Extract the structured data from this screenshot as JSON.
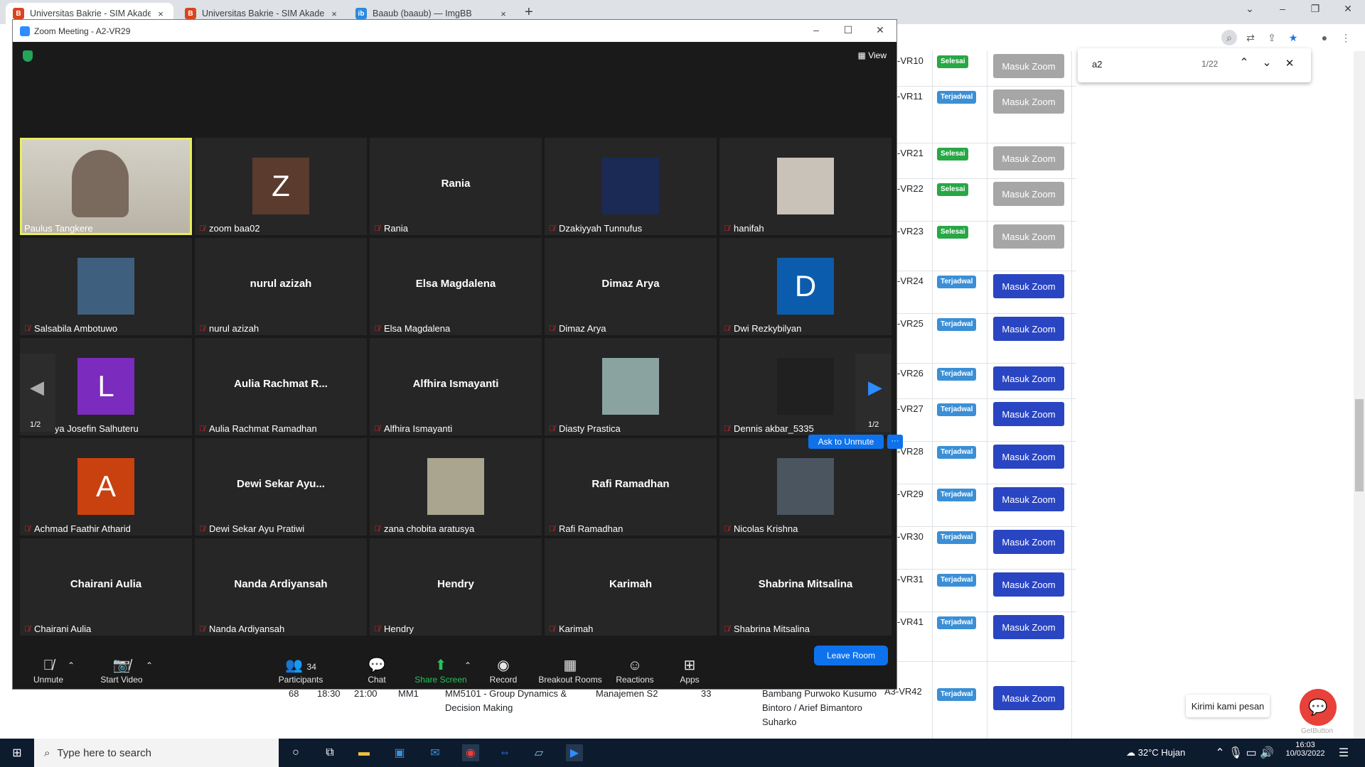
{
  "browser": {
    "tabs": [
      {
        "title": "Universitas Bakrie - SIM Akadem",
        "fav": "B",
        "favColor": "#d9451f"
      },
      {
        "title": "Universitas Bakrie - SIM Akadem",
        "fav": "B",
        "favColor": "#d9451f"
      },
      {
        "title": "Baaub (baaub) — ImgBB",
        "fav": "ib",
        "favColor": "#2b8ae0"
      }
    ],
    "new_tab": "+",
    "close": "×"
  },
  "find": {
    "query": "a2",
    "count": "1/22"
  },
  "schedule": {
    "rows": [
      {
        "room": "-VR10",
        "status": "Selesai",
        "button": "Masuk Zoom",
        "enabled": false
      },
      {
        "room": "-VR11",
        "status": "Terjadwal",
        "button": "Masuk Zoom",
        "enabled": false
      },
      {
        "room": "-VR21",
        "status": "Selesai",
        "button": "Masuk Zoom",
        "enabled": false
      },
      {
        "room": "-VR22",
        "status": "Selesai",
        "button": "Masuk Zoom",
        "enabled": false
      },
      {
        "room": "-VR23",
        "status": "Selesai",
        "button": "Masuk Zoom",
        "enabled": false
      },
      {
        "room": "-VR24",
        "status": "Terjadwal",
        "button": "Masuk Zoom",
        "enabled": true
      },
      {
        "room": "-VR25",
        "status": "Terjadwal",
        "button": "Masuk Zoom",
        "enabled": true
      },
      {
        "room": "-VR26",
        "status": "Terjadwal",
        "button": "Masuk Zoom",
        "enabled": true
      },
      {
        "room": "-VR27",
        "status": "Terjadwal",
        "button": "Masuk Zoom",
        "enabled": true
      },
      {
        "room": "-VR28",
        "status": "Terjadwal",
        "button": "Masuk Zoom",
        "enabled": true
      },
      {
        "room": "-VR29",
        "status": "Terjadwal",
        "button": "Masuk Zoom",
        "enabled": true
      },
      {
        "room": "-VR30",
        "status": "Terjadwal",
        "button": "Masuk Zoom",
        "enabled": true
      },
      {
        "room": "-VR31",
        "status": "Terjadwal",
        "button": "Masuk Zoom",
        "enabled": true
      },
      {
        "room": "-VR41",
        "status": "Terjadwal",
        "button": "Masuk Zoom",
        "enabled": true
      }
    ],
    "last_row": {
      "no": "68",
      "start": "18:30",
      "end": "21:00",
      "class": "MM1",
      "course": "MM5101 - Group Dynamics & Decision Making",
      "program": "Manajemen S2",
      "count": "33",
      "lecturer": "Bambang Purwoko Kusumo Bintoro / Arief Bimantoro Suharko",
      "room": "A3-VR42",
      "status": "Terjadwal",
      "button": "Masuk Zoom"
    }
  },
  "chat_widget": {
    "label": "Kirimi kami pesan",
    "brand": "GetButton"
  },
  "zoom": {
    "title": "Zoom Meeting - A2-VR29",
    "view": "View",
    "page_indicator": "1/2",
    "ask_to_unmute": "Ask to Unmute",
    "more": "···",
    "participants": [
      {
        "name": "Paulus Tangkere",
        "big": "",
        "avatar": "video",
        "color": ""
      },
      {
        "name": "zoom baa02",
        "big": "",
        "avatar": "Z",
        "color": "#5a3b2e"
      },
      {
        "name": "Rania",
        "big": "Rania",
        "avatar": "",
        "color": ""
      },
      {
        "name": "Dzakiyyah Tunnufus",
        "big": "",
        "avatar": "photo",
        "color": "#1b2a55"
      },
      {
        "name": "hanifah",
        "big": "",
        "avatar": "photo",
        "color": "#c8c2b8"
      },
      {
        "name": "Salsabila Ambotuwo",
        "big": "",
        "avatar": "photo",
        "color": "#3f5f7f"
      },
      {
        "name": "nurul azizah",
        "big": "nurul azizah",
        "avatar": "",
        "color": ""
      },
      {
        "name": "Elsa Magdalena",
        "big": "Elsa Magdalena",
        "avatar": "",
        "color": ""
      },
      {
        "name": "Dimaz Arya",
        "big": "Dimaz Arya",
        "avatar": "",
        "color": ""
      },
      {
        "name": "Dwi Rezkybilyan",
        "big": "",
        "avatar": "D",
        "color": "#0b5cad"
      },
      {
        "name": "Loudya Josefin Salhuteru",
        "big": "",
        "avatar": "L",
        "color": "#7b2bbd"
      },
      {
        "name": "Aulia Rachmat Ramadhan",
        "big": "Aulia Rachmat R...",
        "avatar": "",
        "color": ""
      },
      {
        "name": "Alfhira Ismayanti",
        "big": "Alfhira Ismayanti",
        "avatar": "",
        "color": ""
      },
      {
        "name": "Diasty Prastica",
        "big": "",
        "avatar": "photo",
        "color": "#8aa3a0"
      },
      {
        "name": "Dennis akbar_5335",
        "big": "",
        "avatar": "photo",
        "color": "#202020"
      },
      {
        "name": "Achmad Faathir Atharid",
        "big": "",
        "avatar": "A",
        "color": "#c9410f"
      },
      {
        "name": "Dewi Sekar Ayu Pratiwi",
        "big": "Dewi Sekar Ayu...",
        "avatar": "",
        "color": ""
      },
      {
        "name": "zana chobita aratusya",
        "big": "",
        "avatar": "photo",
        "color": "#a9a58e"
      },
      {
        "name": "Rafi Ramadhan",
        "big": "Rafi Ramadhan",
        "avatar": "",
        "color": ""
      },
      {
        "name": "Nicolas Krishna",
        "big": "",
        "avatar": "photo",
        "color": "#4a5560"
      },
      {
        "name": "Chairani Aulia",
        "big": "Chairani Aulia",
        "avatar": "",
        "color": ""
      },
      {
        "name": "Nanda Ardiyansah",
        "big": "Nanda Ardiyansah",
        "avatar": "",
        "color": ""
      },
      {
        "name": "Hendry",
        "big": "Hendry",
        "avatar": "",
        "color": ""
      },
      {
        "name": "Karimah",
        "big": "Karimah",
        "avatar": "",
        "color": ""
      },
      {
        "name": "Shabrina Mitsalina",
        "big": "Shabrina Mitsalina",
        "avatar": "",
        "color": ""
      }
    ],
    "toolbar": {
      "unmute": "Unmute",
      "start_video": "Start Video",
      "participants": "Participants",
      "participants_count": "34",
      "chat": "Chat",
      "share": "Share Screen",
      "record": "Record",
      "breakout": "Breakout Rooms",
      "reactions": "Reactions",
      "apps": "Apps",
      "leave": "Leave Room"
    }
  },
  "taskbar": {
    "search": "Type here to search",
    "weather": "32°C  Hujan",
    "time": "16:03",
    "date": "10/03/2022"
  }
}
